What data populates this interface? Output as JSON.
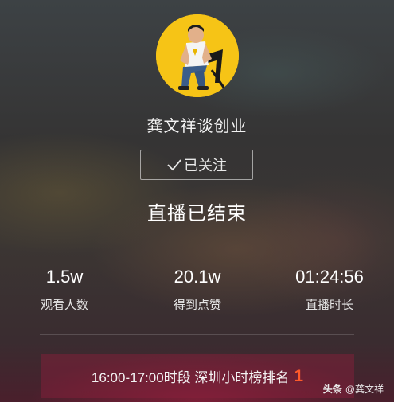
{
  "profile": {
    "name": "龚文祥谈创业",
    "avatar_bg": "#f6c416",
    "follow_label": "已关注",
    "follow_icon": "check-icon"
  },
  "status": {
    "title": "直播已结束"
  },
  "stats": [
    {
      "value": "1.5w",
      "label": "观看人数"
    },
    {
      "value": "20.1w",
      "label": "得到点赞"
    },
    {
      "value": "01:24:56",
      "label": "直播时长"
    }
  ],
  "ranking": {
    "text": "16:00-17:00时段 深圳小时榜排名",
    "rank": "1",
    "rank_color": "#ff5a2a"
  },
  "watermark": {
    "brand": "头条",
    "handle": "@龚文祥"
  }
}
